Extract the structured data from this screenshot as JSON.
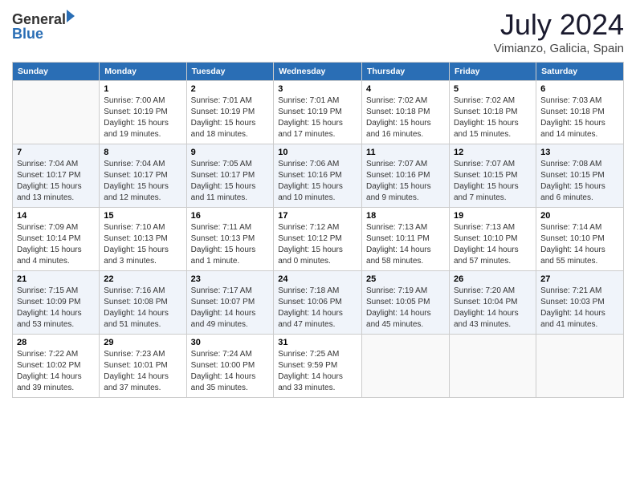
{
  "header": {
    "logo_general": "General",
    "logo_blue": "Blue",
    "title": "July 2024",
    "location": "Vimianzo, Galicia, Spain"
  },
  "days_of_week": [
    "Sunday",
    "Monday",
    "Tuesday",
    "Wednesday",
    "Thursday",
    "Friday",
    "Saturday"
  ],
  "weeks": [
    [
      {
        "day": "",
        "info": ""
      },
      {
        "day": "1",
        "info": "Sunrise: 7:00 AM\nSunset: 10:19 PM\nDaylight: 15 hours\nand 19 minutes."
      },
      {
        "day": "2",
        "info": "Sunrise: 7:01 AM\nSunset: 10:19 PM\nDaylight: 15 hours\nand 18 minutes."
      },
      {
        "day": "3",
        "info": "Sunrise: 7:01 AM\nSunset: 10:19 PM\nDaylight: 15 hours\nand 17 minutes."
      },
      {
        "day": "4",
        "info": "Sunrise: 7:02 AM\nSunset: 10:18 PM\nDaylight: 15 hours\nand 16 minutes."
      },
      {
        "day": "5",
        "info": "Sunrise: 7:02 AM\nSunset: 10:18 PM\nDaylight: 15 hours\nand 15 minutes."
      },
      {
        "day": "6",
        "info": "Sunrise: 7:03 AM\nSunset: 10:18 PM\nDaylight: 15 hours\nand 14 minutes."
      }
    ],
    [
      {
        "day": "7",
        "info": "Sunrise: 7:04 AM\nSunset: 10:17 PM\nDaylight: 15 hours\nand 13 minutes."
      },
      {
        "day": "8",
        "info": "Sunrise: 7:04 AM\nSunset: 10:17 PM\nDaylight: 15 hours\nand 12 minutes."
      },
      {
        "day": "9",
        "info": "Sunrise: 7:05 AM\nSunset: 10:17 PM\nDaylight: 15 hours\nand 11 minutes."
      },
      {
        "day": "10",
        "info": "Sunrise: 7:06 AM\nSunset: 10:16 PM\nDaylight: 15 hours\nand 10 minutes."
      },
      {
        "day": "11",
        "info": "Sunrise: 7:07 AM\nSunset: 10:16 PM\nDaylight: 15 hours\nand 9 minutes."
      },
      {
        "day": "12",
        "info": "Sunrise: 7:07 AM\nSunset: 10:15 PM\nDaylight: 15 hours\nand 7 minutes."
      },
      {
        "day": "13",
        "info": "Sunrise: 7:08 AM\nSunset: 10:15 PM\nDaylight: 15 hours\nand 6 minutes."
      }
    ],
    [
      {
        "day": "14",
        "info": "Sunrise: 7:09 AM\nSunset: 10:14 PM\nDaylight: 15 hours\nand 4 minutes."
      },
      {
        "day": "15",
        "info": "Sunrise: 7:10 AM\nSunset: 10:13 PM\nDaylight: 15 hours\nand 3 minutes."
      },
      {
        "day": "16",
        "info": "Sunrise: 7:11 AM\nSunset: 10:13 PM\nDaylight: 15 hours\nand 1 minute."
      },
      {
        "day": "17",
        "info": "Sunrise: 7:12 AM\nSunset: 10:12 PM\nDaylight: 15 hours\nand 0 minutes."
      },
      {
        "day": "18",
        "info": "Sunrise: 7:13 AM\nSunset: 10:11 PM\nDaylight: 14 hours\nand 58 minutes."
      },
      {
        "day": "19",
        "info": "Sunrise: 7:13 AM\nSunset: 10:10 PM\nDaylight: 14 hours\nand 57 minutes."
      },
      {
        "day": "20",
        "info": "Sunrise: 7:14 AM\nSunset: 10:10 PM\nDaylight: 14 hours\nand 55 minutes."
      }
    ],
    [
      {
        "day": "21",
        "info": "Sunrise: 7:15 AM\nSunset: 10:09 PM\nDaylight: 14 hours\nand 53 minutes."
      },
      {
        "day": "22",
        "info": "Sunrise: 7:16 AM\nSunset: 10:08 PM\nDaylight: 14 hours\nand 51 minutes."
      },
      {
        "day": "23",
        "info": "Sunrise: 7:17 AM\nSunset: 10:07 PM\nDaylight: 14 hours\nand 49 minutes."
      },
      {
        "day": "24",
        "info": "Sunrise: 7:18 AM\nSunset: 10:06 PM\nDaylight: 14 hours\nand 47 minutes."
      },
      {
        "day": "25",
        "info": "Sunrise: 7:19 AM\nSunset: 10:05 PM\nDaylight: 14 hours\nand 45 minutes."
      },
      {
        "day": "26",
        "info": "Sunrise: 7:20 AM\nSunset: 10:04 PM\nDaylight: 14 hours\nand 43 minutes."
      },
      {
        "day": "27",
        "info": "Sunrise: 7:21 AM\nSunset: 10:03 PM\nDaylight: 14 hours\nand 41 minutes."
      }
    ],
    [
      {
        "day": "28",
        "info": "Sunrise: 7:22 AM\nSunset: 10:02 PM\nDaylight: 14 hours\nand 39 minutes."
      },
      {
        "day": "29",
        "info": "Sunrise: 7:23 AM\nSunset: 10:01 PM\nDaylight: 14 hours\nand 37 minutes."
      },
      {
        "day": "30",
        "info": "Sunrise: 7:24 AM\nSunset: 10:00 PM\nDaylight: 14 hours\nand 35 minutes."
      },
      {
        "day": "31",
        "info": "Sunrise: 7:25 AM\nSunset: 9:59 PM\nDaylight: 14 hours\nand 33 minutes."
      },
      {
        "day": "",
        "info": ""
      },
      {
        "day": "",
        "info": ""
      },
      {
        "day": "",
        "info": ""
      }
    ]
  ]
}
